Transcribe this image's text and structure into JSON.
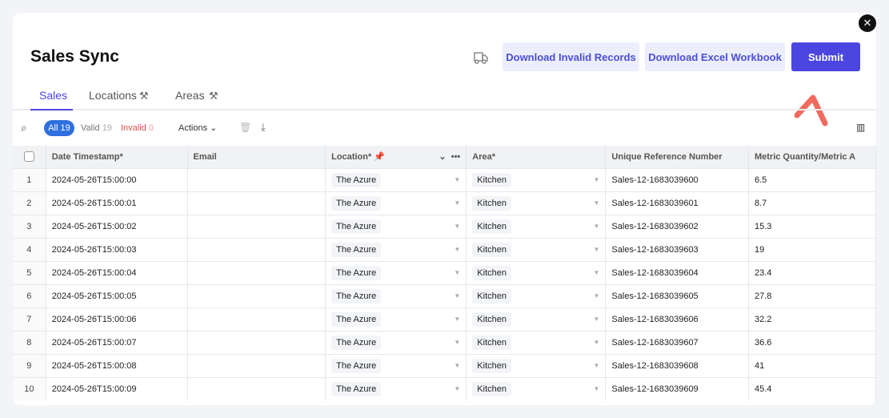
{
  "title": "Sales Sync",
  "buttons": {
    "download_invalid": "Download Invalid Records",
    "download_excel": "Download Excel Workbook",
    "submit": "Submit",
    "close": "✕"
  },
  "tabs": [
    {
      "label": "Sales"
    },
    {
      "label": "Locations"
    },
    {
      "label": "Areas"
    }
  ],
  "toolbar": {
    "all_label": "All",
    "all_count": "19",
    "valid_label": "Valid",
    "valid_count": "19",
    "invalid_label": "Invalid",
    "invalid_count": "0",
    "actions": "Actions"
  },
  "columns": [
    "Date Timestamp*",
    "Email",
    "Location*",
    "Area*",
    "Unique Reference Number",
    "Metric Quantity/Metric A"
  ],
  "rows": [
    {
      "n": "1",
      "date": "2024-05-26T15:00:00",
      "email": "",
      "location": "The Azure",
      "area": "Kitchen",
      "ref": "Sales-12-1683039600",
      "qty": "6.5"
    },
    {
      "n": "2",
      "date": "2024-05-26T15:00:01",
      "email": "",
      "location": "The Azure",
      "area": "Kitchen",
      "ref": "Sales-12-1683039601",
      "qty": "8.7"
    },
    {
      "n": "3",
      "date": "2024-05-26T15:00:02",
      "email": "",
      "location": "The Azure",
      "area": "Kitchen",
      "ref": "Sales-12-1683039602",
      "qty": "15.3"
    },
    {
      "n": "4",
      "date": "2024-05-26T15:00:03",
      "email": "",
      "location": "The Azure",
      "area": "Kitchen",
      "ref": "Sales-12-1683039603",
      "qty": "19"
    },
    {
      "n": "5",
      "date": "2024-05-26T15:00:04",
      "email": "",
      "location": "The Azure",
      "area": "Kitchen",
      "ref": "Sales-12-1683039604",
      "qty": "23.4"
    },
    {
      "n": "6",
      "date": "2024-05-26T15:00:05",
      "email": "",
      "location": "The Azure",
      "area": "Kitchen",
      "ref": "Sales-12-1683039605",
      "qty": "27.8"
    },
    {
      "n": "7",
      "date": "2024-05-26T15:00:06",
      "email": "",
      "location": "The Azure",
      "area": "Kitchen",
      "ref": "Sales-12-1683039606",
      "qty": "32.2"
    },
    {
      "n": "8",
      "date": "2024-05-26T15:00:07",
      "email": "",
      "location": "The Azure",
      "area": "Kitchen",
      "ref": "Sales-12-1683039607",
      "qty": "36.6"
    },
    {
      "n": "9",
      "date": "2024-05-26T15:00:08",
      "email": "",
      "location": "The Azure",
      "area": "Kitchen",
      "ref": "Sales-12-1683039608",
      "qty": "41"
    },
    {
      "n": "10",
      "date": "2024-05-26T15:00:09",
      "email": "",
      "location": "The Azure",
      "area": "Kitchen",
      "ref": "Sales-12-1683039609",
      "qty": "45.4"
    }
  ]
}
